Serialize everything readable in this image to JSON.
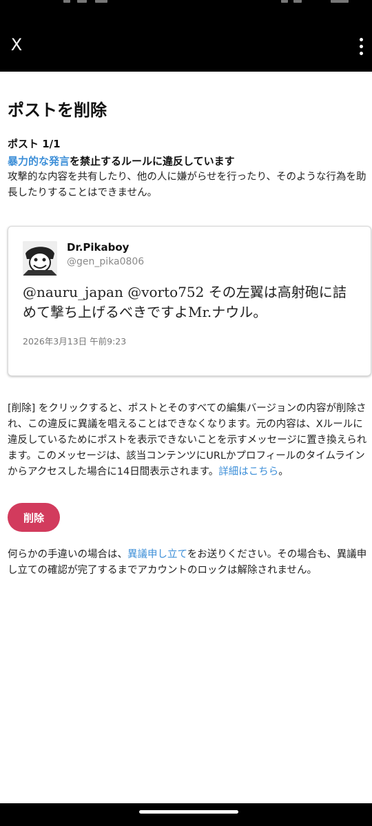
{
  "appbar": {
    "close_icon": "close-x-icon",
    "menu_icon": "more-vertical-icon"
  },
  "page": {
    "title": "ポストを削除",
    "counter": "ポスト 1/1",
    "rule_link": "暴力的な発言",
    "rule_suffix": "を禁止するルールに違反しています",
    "rule_description": "攻撃的な内容を共有したり、他の人に嫌がらせを行ったり、そのような行為を助長したりすることはできません。"
  },
  "tweet": {
    "author_name": "Dr.Pikaboy",
    "author_handle": "@gen_pika0806",
    "text": "@nauru_japan @vorto752 その左翼は高射砲に詰めて撃ち上げるべきですよMr.ナウル。",
    "date": "2026年3月13日 午前9:23",
    "avatar_icon": "manga-character-avatar"
  },
  "notice": {
    "text": "[削除] をクリックすると、ポストとそのすべての編集バージョンの内容が削除され、この違反に異議を唱えることはできなくなります。元の内容は、Xルールに違反しているためにポストを表示できないことを示すメッセージに置き換えられます。このメッセージは、該当コンテンツにURLかプロフィールのタイムラインからアクセスした場合に14日間表示されます。",
    "link": "詳細はこちら",
    "end": "。"
  },
  "delete_button": {
    "label": "削除",
    "color": "#d23b5d"
  },
  "appeal": {
    "prefix": "何らかの手違いの場合は、",
    "link": "異議申し立て",
    "suffix": "をお送りください。その場合も、異議申し立ての確認が完了するまでアカウントのロックは解除されません。"
  },
  "colors": {
    "link": "#3d8fd8",
    "bar": "#000000"
  }
}
